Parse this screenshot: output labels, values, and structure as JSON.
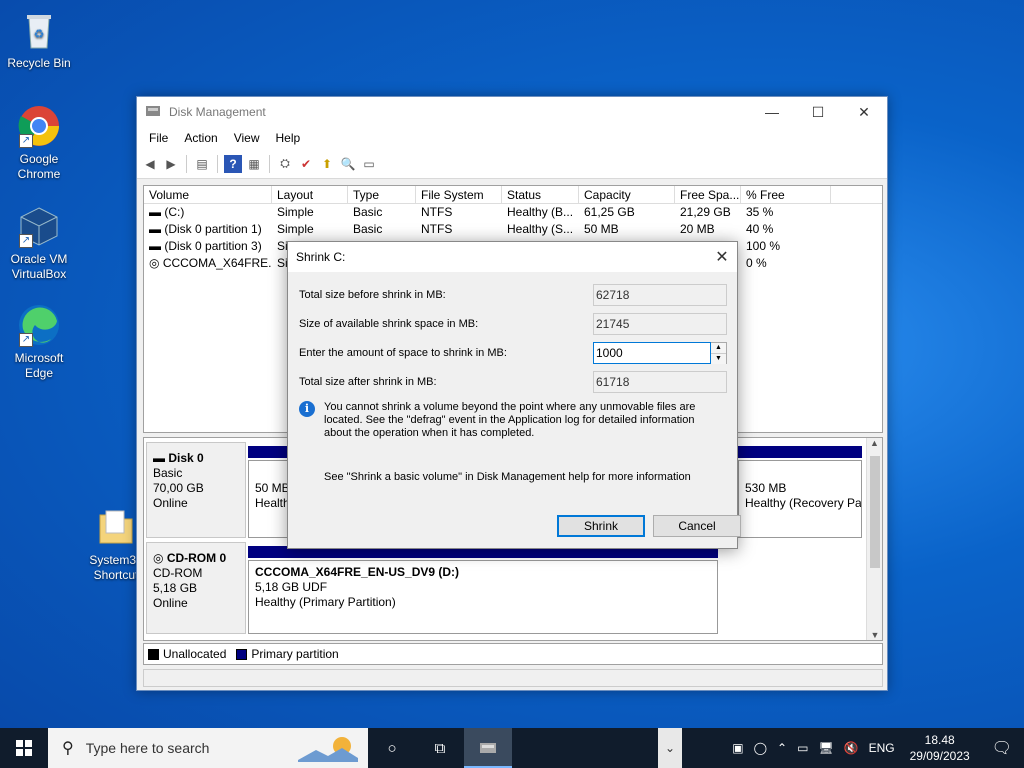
{
  "desktop": {
    "icons": [
      {
        "label": "Recycle Bin"
      },
      {
        "label": "Google Chrome"
      },
      {
        "label": "Oracle VM VirtualBox"
      },
      {
        "label": "Microsoft Edge"
      },
      {
        "label": "System32 Shortcut"
      }
    ]
  },
  "window": {
    "title": "Disk Management",
    "menu": [
      "File",
      "Action",
      "View",
      "Help"
    ],
    "columns": [
      "Volume",
      "Layout",
      "Type",
      "File System",
      "Status",
      "Capacity",
      "Free Spa...",
      "% Free"
    ],
    "volumes": [
      {
        "volume": "(C:)",
        "layout": "Simple",
        "type": "Basic",
        "fs": "NTFS",
        "status": "Healthy (B...",
        "capacity": "61,25 GB",
        "free": "21,29 GB",
        "pct": "35 %"
      },
      {
        "volume": "(Disk 0 partition 1)",
        "layout": "Simple",
        "type": "Basic",
        "fs": "NTFS",
        "status": "Healthy (S...",
        "capacity": "50 MB",
        "free": "20 MB",
        "pct": "40 %"
      },
      {
        "volume": "(Disk 0 partition 3)",
        "layout": "Si",
        "type": "",
        "fs": "",
        "status": "",
        "capacity": "",
        "free": "",
        "pct": "100 %"
      },
      {
        "volume": "CCCOMA_X64FRE...",
        "layout": "Si",
        "type": "",
        "fs": "",
        "status": "",
        "capacity": "",
        "free": "",
        "pct": "0 %"
      }
    ],
    "disks": {
      "disk0": {
        "name": "Disk 0",
        "type": "Basic",
        "size": "70,00 GB",
        "state": "Online",
        "part1_size": "50 MB",
        "part1_status": "Health",
        "part3_size": "530 MB",
        "part3_status": "Healthy (Recovery Pa"
      },
      "cdrom0": {
        "name": "CD-ROM 0",
        "type": "CD-ROM",
        "size": "5,18 GB",
        "state": "Online",
        "vol_name": "CCCOMA_X64FRE_EN-US_DV9  (D:)",
        "vol_size": "5,18 GB UDF",
        "vol_status": "Healthy (Primary Partition)"
      }
    },
    "legend": {
      "unallocated": "Unallocated",
      "primary": "Primary partition"
    }
  },
  "dialog": {
    "title": "Shrink C:",
    "total_before_label": "Total size before shrink in MB:",
    "total_before_value": "62718",
    "available_label": "Size of available shrink space in MB:",
    "available_value": "21745",
    "amount_label": "Enter the amount of space to shrink in MB:",
    "amount_value": "1000",
    "total_after_label": "Total size after shrink in MB:",
    "total_after_value": "61718",
    "info_text": "You cannot shrink a volume beyond the point where any unmovable files are located. See the \"defrag\" event in the Application log for detailed information about the operation when it has completed.",
    "help_text": "See \"Shrink a basic volume\" in Disk Management help for more information",
    "shrink_label": "Shrink",
    "cancel_label": "Cancel"
  },
  "taskbar": {
    "search_placeholder": "Type here to search",
    "language": "ENG",
    "time": "18.48",
    "date": "29/09/2023"
  },
  "colors": {
    "primary_partition": "#000080",
    "accent": "#0078d7"
  }
}
